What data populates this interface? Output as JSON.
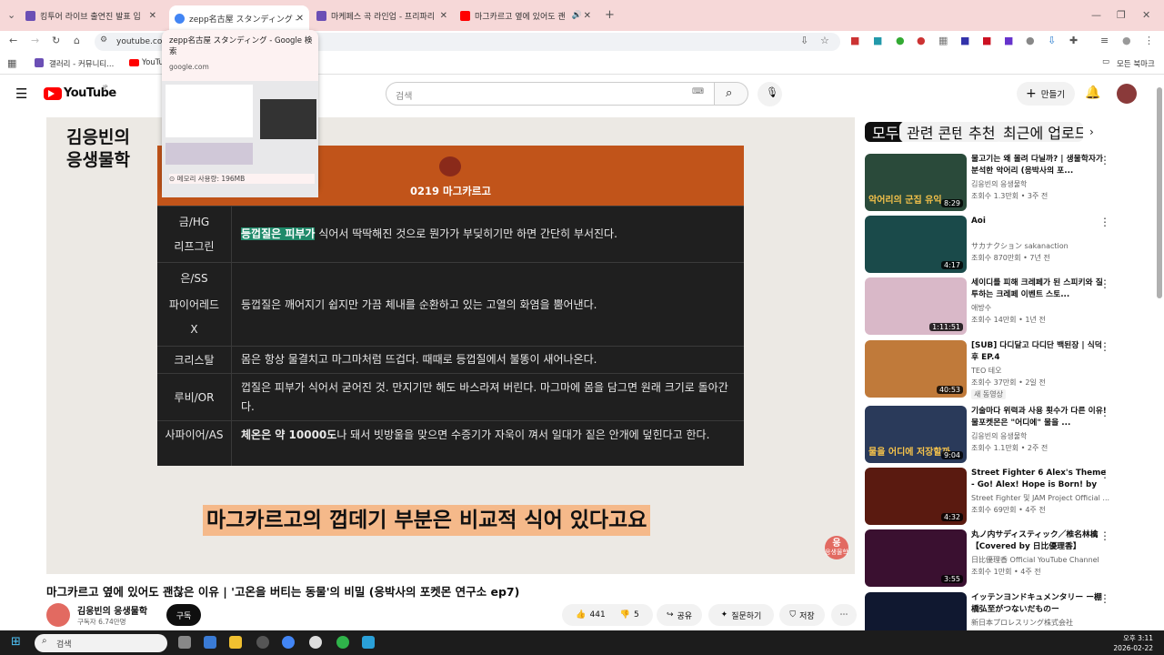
{
  "browser": {
    "tabs": [
      {
        "title": "킹투어 라이브 출연진 발표 입",
        "favicon_color": "#6b4fb5"
      },
      {
        "title": "zepp名古屋 スタンディング -",
        "favicon_color": "#4285f4"
      },
      {
        "title": "마케페스 곡 라인업 - 프리파리",
        "favicon_color": "#6b4fb5"
      },
      {
        "title": "마그카르고 옆에 있어도 괜",
        "favicon_color": "#ff0000"
      }
    ],
    "new_tab": "+",
    "url": "youtube.com",
    "bookmarks": [
      "갤러리 - 커뮤니티...",
      "YouTube"
    ],
    "all_bookmarks": "모든 북마크",
    "hover_card": {
      "title": "zepp名古屋 スタンディング - Google 検索",
      "domain": "google.com",
      "memory": "메모리 사용량: 196MB"
    }
  },
  "youtube": {
    "logo_text": "YouTube",
    "region": "JP",
    "search_placeholder": "검색",
    "create_label": "만들기",
    "video": {
      "channel_stamp": "김응빈의\n응생물학",
      "card_title": "0219 마그카르고",
      "rows": [
        {
          "label": "금/HG",
          "text": ""
        },
        {
          "label": "리프그린",
          "highlight": "등껍질은 피부가",
          "text": " 식어서 딱딱해진 것으로 뭔가가 부딪히기만 하면 간단히 부서진다."
        },
        {
          "label": "은/SS",
          "text": ""
        },
        {
          "label": "파이어레드",
          "text": "등껍질은 깨어지기 쉽지만 가끔 체내를 순환하고 있는 고열의 화염을 뿜어낸다."
        },
        {
          "label": "X",
          "text": ""
        },
        {
          "label": "크리스탈",
          "text": "몸은 항상 물결치고 마그마처럼 뜨겁다. 때때로 등껍질에서 불똥이 새어나온다."
        },
        {
          "label": "루비/OR",
          "text": "껍질은 피부가 식어서 굳어진 것. 만지기만 해도 바스라져 버린다. 마그마에 몸을 담그면 원래 크기로 돌아간다."
        },
        {
          "label": "사파이어/AS",
          "bold": "체온은 약 10000도",
          "text": "나 돼서 빗방울을 맞으면 수증기가 자욱이 껴서 일대가 짙은 안개에 덮힌다고 한다."
        }
      ],
      "subtitle": "마그카르고의 껍데기 부분은 비교적 식어 있다고요",
      "corner_badge": "응생물학"
    },
    "title": "마그카르고 옆에 있어도 괜찮은 이유 | '고온을 버티는 동물'의 비밀 (응박사의 포켓몬 연구소 ep7)",
    "channel_name": "김응빈의 응생물학",
    "subscribers": "구독자 6.74만명",
    "subscribe": "구독",
    "likes": "441",
    "dislikes": "5",
    "share": "공유",
    "ask": "질문하기",
    "save": "저장",
    "chips": [
      "모두",
      "관련 콘텐츠",
      "추천",
      "최근에 업로드된 동영"
    ],
    "recommendations": [
      {
        "title": "물고기는 왜 몰려 다닐까? | 생물학자가 분석한 악어리 (응박사의 포...",
        "channel": "김응빈의 응생물학",
        "meta": "조회수 1.3만회 • 3주 전",
        "duration": "8:29",
        "thumb_color": "#2a4a3a",
        "thumb_text": "악어리의 군집 유익"
      },
      {
        "title": "Aoi",
        "channel": "サカナクション sakanaction",
        "meta": "조회수 870만회 • 7년 전",
        "duration": "4:17",
        "thumb_color": "#1a4a4a",
        "thumb_text": ""
      },
      {
        "title": "세이디를 피해 크레페가 된 스피키와 질투하는 크레페 이벤트 스토...",
        "channel": "애방수",
        "meta": "조회수 14만회 • 1년 전",
        "duration": "1:11:51",
        "thumb_color": "#d9b8c8",
        "thumb_text": ""
      },
      {
        "title": "[SUB] 다디달고 다디단 백된장 | 식덕후 EP.4",
        "channel": "TEO 테오",
        "meta": "조회수 37만회 • 2일 전",
        "badge": "새 동영상",
        "duration": "40:53",
        "thumb_color": "#c07a3a",
        "thumb_text": ""
      },
      {
        "title": "기술마다 위력과 사용 횟수가 다른 이유! 물포켓몬은 \"어디에\" 물을 ...",
        "channel": "김응빈의 응생물학",
        "meta": "조회수 1.1만회 • 2주 전",
        "duration": "9:04",
        "thumb_color": "#2a3a5a",
        "thumb_text": "물을 어디에 저장할까"
      },
      {
        "title": "Street Fighter 6 Alex's Theme - Go! Alex! Hope is Born! by JA...",
        "channel": "Street Fighter 및 JAM Project Official ...",
        "meta": "조회수 69만회 • 4주 전",
        "duration": "4:32",
        "thumb_color": "#5a1a10",
        "thumb_text": ""
      },
      {
        "title": "丸ノ内サディスティック／椎名林檎【Covered by 日比優理香】",
        "channel": "日比優理香 Official YouTube Channel",
        "meta": "조회수 1만회 • 4주 전",
        "duration": "3:55",
        "thumb_color": "#3a1030",
        "thumb_text": ""
      },
      {
        "title": "イッテンヨンドキュメンタリー ー棚橋弘至がつないだものー",
        "channel": "新日本プロレスリング株式会社",
        "meta": "",
        "duration": "",
        "thumb_color": "#101830",
        "thumb_text": ""
      }
    ]
  },
  "taskbar": {
    "search_placeholder": "검색",
    "time": "오후 3:11",
    "date": "2026-02-22"
  }
}
